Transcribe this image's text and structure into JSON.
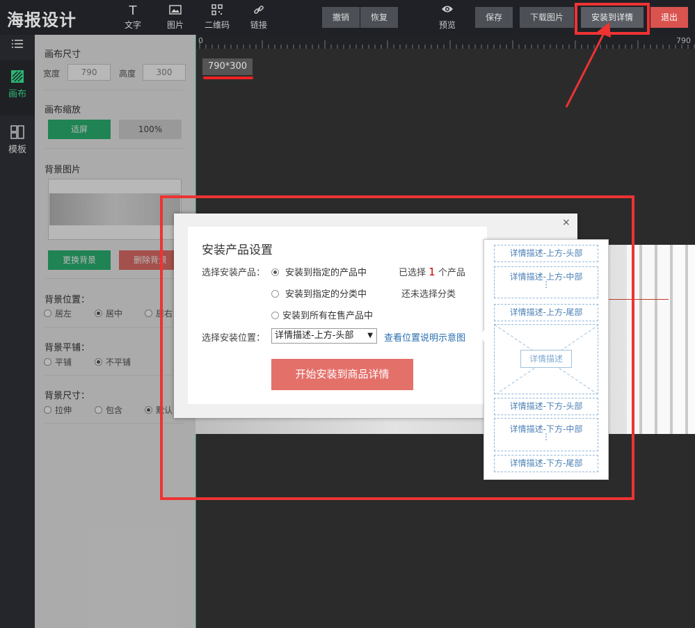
{
  "app": {
    "logo": "海报设计"
  },
  "toolbar": {
    "tools": [
      {
        "label": "文字",
        "icon": "text-icon"
      },
      {
        "label": "图片",
        "icon": "image-icon"
      },
      {
        "label": "二维码",
        "icon": "qrcode-icon"
      },
      {
        "label": "链接",
        "icon": "link-icon"
      }
    ],
    "undo": "撤销",
    "redo": "恢复",
    "preview": "预览",
    "save": "保存",
    "download": "下载图片",
    "install": "安装到详情",
    "exit": "退出",
    "colors": {
      "exit": "#d9534f",
      "highlight": "#ee3333"
    }
  },
  "rail": {
    "items": [
      {
        "label": "画布",
        "icon": "canvas-icon",
        "active": true
      },
      {
        "label": "模板",
        "icon": "template-icon",
        "active": false
      }
    ],
    "top_icon": "list-icon"
  },
  "panel": {
    "canvas_size": {
      "title": "画布尺寸",
      "width_label": "宽度",
      "width": "790",
      "height_label": "高度",
      "height": "300"
    },
    "zoom": {
      "title": "画布缩放",
      "fit": "适屏",
      "percent": "100%"
    },
    "background": {
      "title": "背景图片",
      "replace": "更换背景",
      "delete": "删除背景"
    },
    "bg_position": {
      "title": "背景位置：",
      "options": [
        "居左",
        "居中",
        "居右"
      ],
      "selected": "居中"
    },
    "bg_tile": {
      "title": "背景平铺：",
      "options": [
        "平铺",
        "不平铺"
      ],
      "selected": "不平铺"
    },
    "bg_size": {
      "title": "背景尺寸：",
      "options": [
        "拉伸",
        "包含",
        "默认"
      ],
      "selected": "默认"
    },
    "colors": {
      "green": "#2bb673",
      "red": "#e4706a"
    }
  },
  "canvas": {
    "ruler_start": "0",
    "ruler_end": "790",
    "size_badge": "790*300"
  },
  "modal": {
    "title": "安装产品设置",
    "close": "×",
    "product_label": "选择安装产品：",
    "options": [
      {
        "label": "安装到指定的产品中",
        "checked": true,
        "status_prefix": "已选择",
        "count": "1",
        "status_suffix": "个产品"
      },
      {
        "label": "安装到指定的分类中",
        "checked": false,
        "status": "还未选择分类"
      },
      {
        "label": "安装到所有在售产品中",
        "checked": false
      }
    ],
    "position_label": "选择安装位置：",
    "position_value": "详情描述-上方-头部",
    "diagram_link": "查看位置说明示意图",
    "start_button": "开始安装到商品详情",
    "count_color": "#cc0000"
  },
  "diagram": {
    "top_items": [
      "详情描述-上方-头部",
      "详情描述-上方-中部",
      "详情描述-上方-尾部"
    ],
    "center": "详情描述",
    "bottom_items": [
      "详情描述-下方-头部",
      "详情描述-下方-中部",
      "详情描述-下方-尾部"
    ]
  }
}
